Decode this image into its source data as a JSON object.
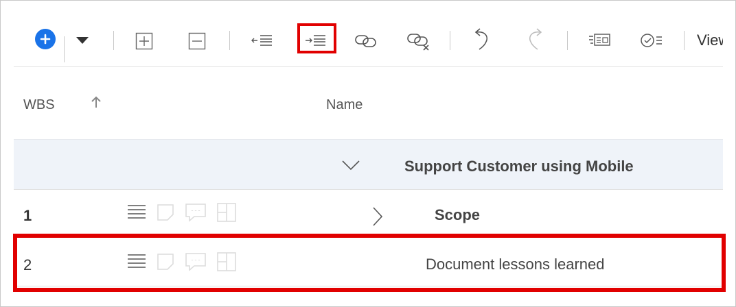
{
  "toolbar": {
    "view_label": "View",
    "buttons": [
      {
        "icon": "add-icon"
      },
      {
        "icon": "chevron-down-icon"
      },
      {
        "icon": "expand-all-icon"
      },
      {
        "icon": "collapse-all-icon"
      },
      {
        "icon": "outdent-icon"
      },
      {
        "icon": "indent-icon"
      },
      {
        "icon": "link-icon"
      },
      {
        "icon": "unlink-icon"
      },
      {
        "icon": "undo-icon"
      },
      {
        "icon": "redo-icon"
      },
      {
        "icon": "details-icon"
      },
      {
        "icon": "checklist-icon"
      }
    ],
    "accent_color": "#1a73e8",
    "highlight_color": "#e10000"
  },
  "grid": {
    "columns": {
      "wbs": "WBS",
      "name": "Name"
    },
    "group": {
      "title": "Support Customer using Mobile"
    },
    "rows": [
      {
        "wbs": "1",
        "name": "Scope",
        "bold": true,
        "has_children": true
      },
      {
        "wbs": "2",
        "name": "Document lessons learned",
        "bold": false,
        "has_children": false
      }
    ]
  }
}
